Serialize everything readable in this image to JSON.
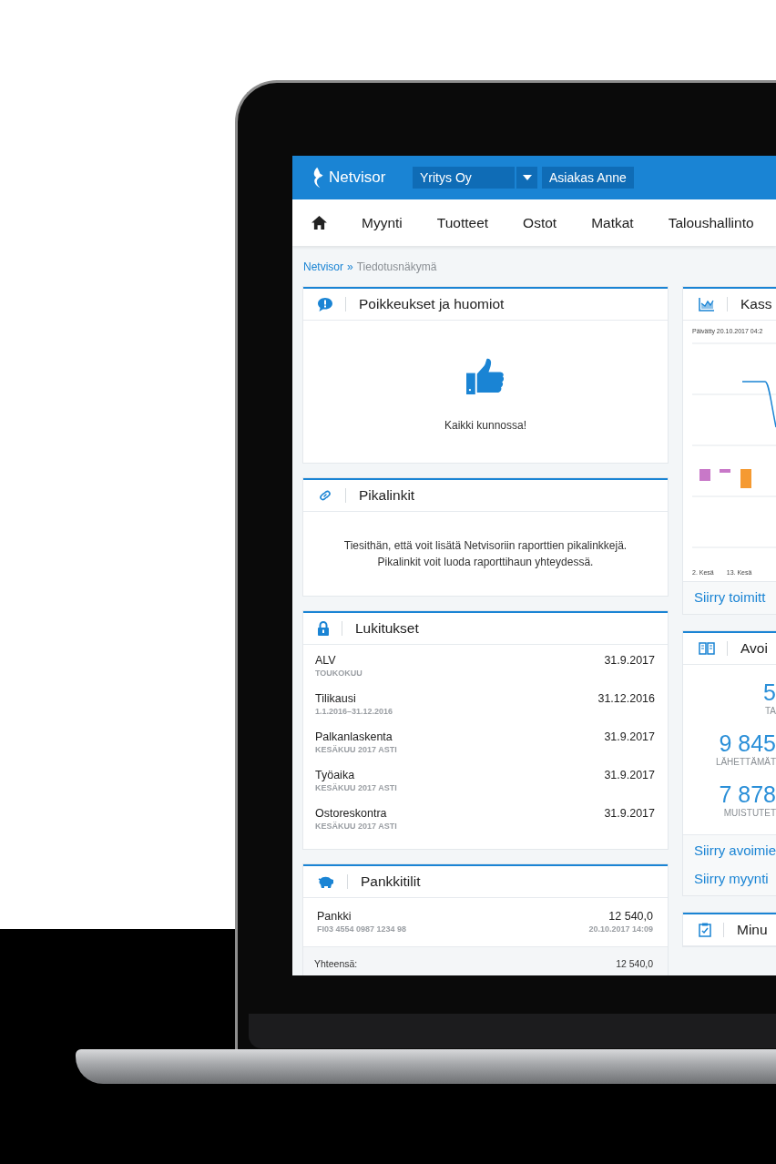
{
  "header": {
    "logo": "Netvisor",
    "company": "Yritys Oy",
    "user": "Asiakas Anne"
  },
  "nav": [
    {
      "label": "Myynti"
    },
    {
      "label": "Tuotteet"
    },
    {
      "label": "Ostot"
    },
    {
      "label": "Matkat"
    },
    {
      "label": "Taloushallinto"
    }
  ],
  "breadcrumb": {
    "root": "Netvisor",
    "separator": "»",
    "current": "Tiedotusnäkymä"
  },
  "left": [
    {
      "kind": "status",
      "title": "Poikkeukset ja huomiot",
      "message": "Kaikki kunnossa!"
    },
    {
      "kind": "info",
      "title": "Pikalinkit",
      "lines": [
        "Tiesithän, että voit lisätä Netvisoriin raporttien pikalinkkejä.",
        "Pikalinkit voit luoda raporttihaun yhteydessä."
      ]
    },
    {
      "kind": "locks",
      "title": "Lukitukset",
      "rows": [
        {
          "name": "ALV",
          "period": "TOUKOKUU",
          "date": "31.9.2017"
        },
        {
          "name": "Tilikausi",
          "period": "1.1.2016–31.12.2016",
          "date": "31.12.2016"
        },
        {
          "name": "Palkanlaskenta",
          "period": "KESÄKUU 2017 ASTI",
          "date": "31.9.2017"
        },
        {
          "name": "Työaika",
          "period": "KESÄKUU 2017 ASTI",
          "date": "31.9.2017"
        },
        {
          "name": "Ostoreskontra",
          "period": "KESÄKUU 2017 ASTI",
          "date": "31.9.2017"
        }
      ]
    },
    {
      "kind": "bank",
      "title": "Pankkitilit",
      "accounts": [
        {
          "name": "Pankki",
          "iban": "FI03 4554 0987 1234 98",
          "balance": "12 540,0",
          "updated": "20.10.2017 14:09"
        }
      ],
      "total_label": "Yhteensä:",
      "total": "12 540,0"
    }
  ],
  "right": [
    {
      "kind": "chart",
      "title": "Kass",
      "updated": "Päivätty 20.10.2017 04:2",
      "x_labels": [
        "2. Kesä",
        "13. Kesä"
      ],
      "link": "Siirry toimitt"
    },
    {
      "kind": "stats",
      "title": "Avoi",
      "stats": [
        {
          "value": "5",
          "label": "TA"
        },
        {
          "value": "9 845",
          "label": "LÄHETTÄMÄT"
        },
        {
          "value": "7 878",
          "label": "MUISTUTET"
        }
      ],
      "links": [
        "Siirry avoimie",
        "Siirry myynti"
      ]
    },
    {
      "kind": "tasks",
      "title": "Minu"
    }
  ]
}
